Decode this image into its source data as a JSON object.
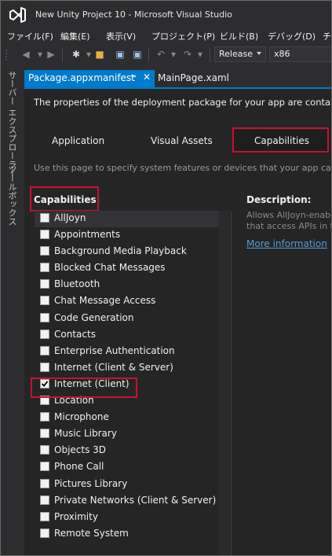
{
  "window": {
    "title": "New Unity Project 10 - Microsoft Visual Studio"
  },
  "menu": [
    "ファイル(F)",
    "編集(E)",
    "表示(V)",
    "プロジェクト(P)",
    "ビルド(B)",
    "デバッグ(D)",
    "チ"
  ],
  "toolbar": {
    "configuration": "Release",
    "platform": "x86"
  },
  "side_tabs": [
    "サーバー エクスプローラー",
    "ツールボックス"
  ],
  "doc_tabs": {
    "active": "Package.appxmanifest",
    "inactive": "MainPage.xaml"
  },
  "manifest": {
    "intro": "The properties of the deployment package for your app are contained in",
    "tabs": [
      "Application",
      "Visual Assets",
      "Capabilities"
    ],
    "selected_tab": "Capabilities",
    "use_text": "Use this page to specify system features or devices that your app can use",
    "capabilities_heading": "Capabilities:",
    "description_heading": "Description:",
    "description_lines": [
      "Allows AllJoyn-enab",
      "that access APIs in th"
    ],
    "more_info": "More information",
    "capabilities": [
      {
        "label": "AllJoyn",
        "checked": false
      },
      {
        "label": "Appointments",
        "checked": false
      },
      {
        "label": "Background Media Playback",
        "checked": false
      },
      {
        "label": "Blocked Chat Messages",
        "checked": false
      },
      {
        "label": "Bluetooth",
        "checked": false
      },
      {
        "label": "Chat Message Access",
        "checked": false
      },
      {
        "label": "Code Generation",
        "checked": false
      },
      {
        "label": "Contacts",
        "checked": false
      },
      {
        "label": "Enterprise Authentication",
        "checked": false
      },
      {
        "label": "Internet (Client & Server)",
        "checked": false
      },
      {
        "label": "Internet (Client)",
        "checked": true
      },
      {
        "label": "Location",
        "checked": false
      },
      {
        "label": "Microphone",
        "checked": false
      },
      {
        "label": "Music Library",
        "checked": false
      },
      {
        "label": "Objects 3D",
        "checked": false
      },
      {
        "label": "Phone Call",
        "checked": false
      },
      {
        "label": "Pictures Library",
        "checked": false
      },
      {
        "label": "Private Networks (Client & Server)",
        "checked": false
      },
      {
        "label": "Proximity",
        "checked": false
      },
      {
        "label": "Remote System",
        "checked": false
      }
    ]
  },
  "colors": {
    "accent": "#007acc",
    "highlight": "#c8102e"
  }
}
